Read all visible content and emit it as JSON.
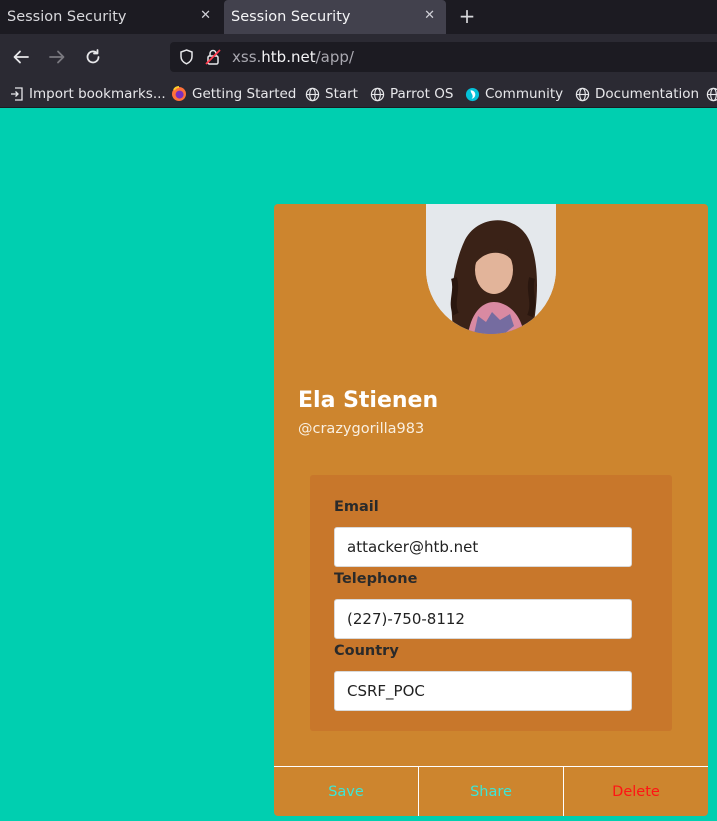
{
  "browser": {
    "tabs": [
      {
        "title": "Session Security",
        "active": false
      },
      {
        "title": "Session Security",
        "active": true
      }
    ],
    "url": {
      "prefix": "xss.",
      "host": "htb.net",
      "path": "/app/"
    },
    "bookmarks": [
      {
        "label": "Import bookmarks...",
        "icon": "import-icon"
      },
      {
        "label": "Getting Started",
        "icon": "firefox-icon"
      },
      {
        "label": "Start",
        "icon": "globe-icon"
      },
      {
        "label": "Parrot OS",
        "icon": "globe-icon"
      },
      {
        "label": "Community",
        "icon": "parrot-icon"
      },
      {
        "label": "Documentation",
        "icon": "globe-icon"
      }
    ]
  },
  "profile": {
    "name": "Ela Stienen",
    "handle": "@crazygorilla983",
    "fields": [
      {
        "label": "Email",
        "value": "attacker@htb.net"
      },
      {
        "label": "Telephone",
        "value": "(227)-750-8112"
      },
      {
        "label": "Country",
        "value": "CSRF_POC"
      }
    ],
    "actions": {
      "save": "Save",
      "share": "Share",
      "delete": "Delete"
    }
  },
  "colors": {
    "page_bg": "#00cfb0",
    "card_bg": "#cd852e",
    "panel_bg": "#c8772b",
    "action_accent": "#3ce6d6",
    "delete_red": "#ff1414"
  }
}
